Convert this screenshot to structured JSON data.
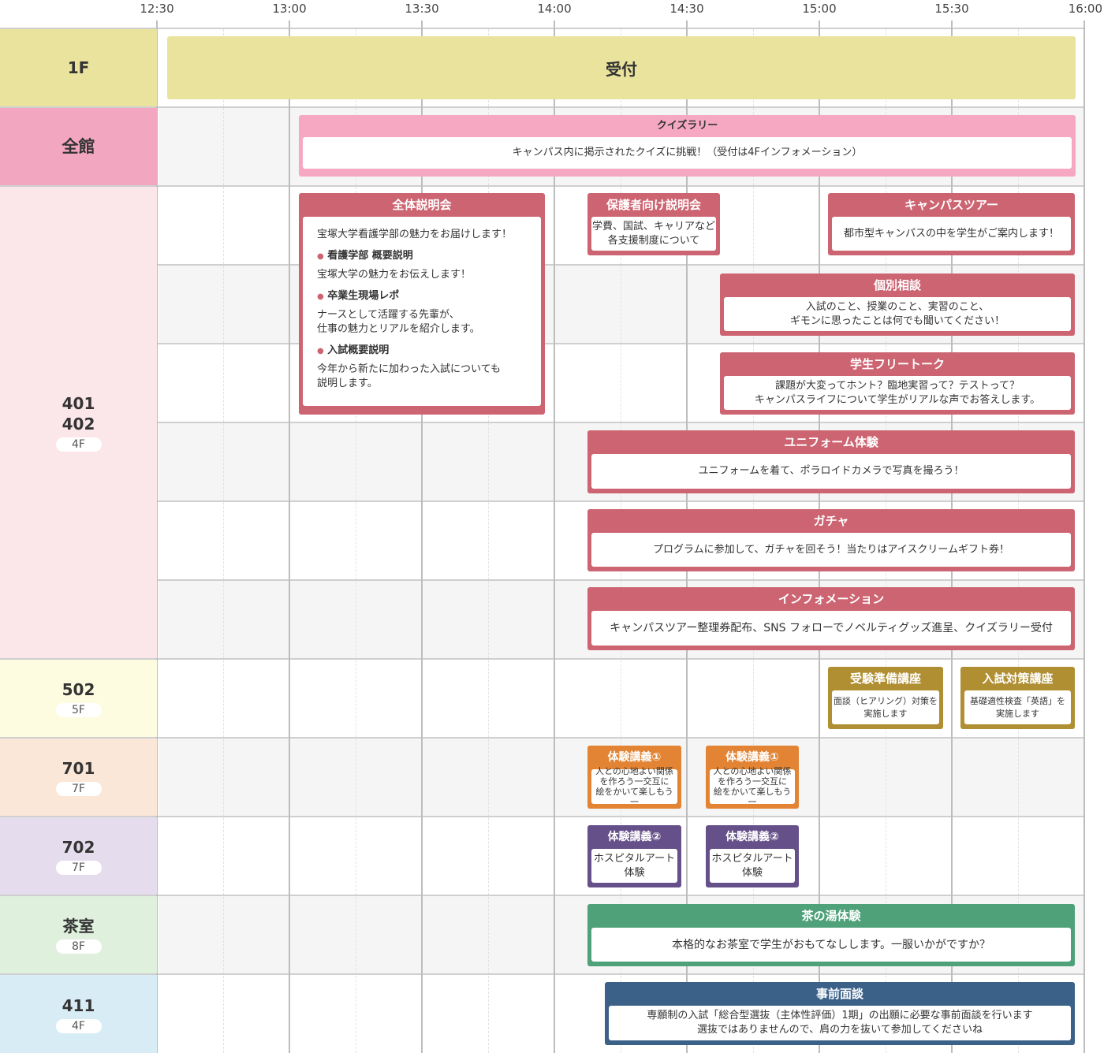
{
  "timeline": [
    "12:30",
    "13:00",
    "13:30",
    "14:00",
    "14:30",
    "15:00",
    "15:30",
    "16:00"
  ],
  "rooms": {
    "r1f": {
      "name": "1F"
    },
    "all": {
      "name": "全館"
    },
    "r401": {
      "name1": "401",
      "name2": "402",
      "floor": "4F"
    },
    "r502": {
      "name": "502",
      "floor": "5F"
    },
    "r701": {
      "name": "701",
      "floor": "7F"
    },
    "r702": {
      "name": "702",
      "floor": "7F"
    },
    "tea": {
      "name": "茶室",
      "floor": "8F"
    },
    "r411": {
      "name": "411",
      "floor": "4F"
    }
  },
  "events": {
    "reception": {
      "title": "受付"
    },
    "quiz": {
      "title": "クイズラリー",
      "body": "キャンパス内に掲示されたクイズに挑戦！（受付は4Fインフォメーション）"
    },
    "briefing": {
      "title": "全体説明会",
      "intro": "宝塚大学看護学部の魅力をお届けします！",
      "items": [
        {
          "head": "看護学部 概要説明",
          "text1": "宝塚大学の魅力をお伝えします！",
          "text2": ""
        },
        {
          "head": "卒業生現場レポ",
          "text1": "ナースとして活躍する先輩が、",
          "text2": "仕事の魅力とリアルを紹介します。"
        },
        {
          "head": "入試概要説明",
          "text1": "今年から新たに加わった入試についても",
          "text2": "説明します。"
        }
      ]
    },
    "parents": {
      "title": "保護者向け説明会",
      "line1": "学費、国試、キャリアなど",
      "line2": "各支援制度について"
    },
    "tour": {
      "title": "キャンパスツアー",
      "body": "都市型キャンパスの中を学生がご案内します！"
    },
    "consult": {
      "title": "個別相談",
      "line1": "入試のこと、授業のこと、実習のこと、",
      "line2": "ギモンに思ったことは何でも聞いてください！"
    },
    "freetalk": {
      "title": "学生フリートーク",
      "line1": "課題が大変ってホント？臨地実習って？テストって？",
      "line2": "キャンパスライフについて学生がリアルな声でお答えします。"
    },
    "uniform": {
      "title": "ユニフォーム体験",
      "body": "ユニフォームを着て、ポラロイドカメラで写真を撮ろう！"
    },
    "gacha": {
      "title": "ガチャ",
      "body": "プログラムに参加して、ガチャを回そう！当たりはアイスクリームギフト券！"
    },
    "info": {
      "title": "インフォメーション",
      "body": "キャンパスツアー整理券配布、SNS フォローでノベルティグッズ進呈、クイズラリー受付"
    },
    "prep": {
      "title": "受験準備講座",
      "line1": "面談（ヒアリング）対策を",
      "line2": "実施します"
    },
    "exam": {
      "title": "入試対策講座",
      "line1": "基礎適性検査「英語」を",
      "line2": "実施します"
    },
    "lec1a": {
      "title": "体験講義①",
      "line1": "人との心地よい関係",
      "line2": "を作ろう一交互に",
      "line3": "絵をかいて楽しもう一"
    },
    "lec1b": {
      "title": "体験講義①",
      "line1": "人との心地よい関係",
      "line2": "を作ろう一交互に",
      "line3": "絵をかいて楽しもう一"
    },
    "lec2a": {
      "title": "体験講義②",
      "line1": "ホスピタルアート",
      "line2": "体験"
    },
    "lec2b": {
      "title": "体験講義②",
      "line1": "ホスピタルアート",
      "line2": "体験"
    },
    "tea": {
      "title": "茶の湯体験",
      "body": "本格的なお茶室で学生がおもてなしします。一服いかがですか？"
    },
    "interview": {
      "title": "事前面談",
      "line1": "専願制の入試「総合型選抜（主体性評価）1期」の出願に必要な事前面談を行います",
      "line2": "選抜ではありませんので、肩の力を抜いて参加してくださいね"
    }
  },
  "colors": {
    "event_red": "#cd6471",
    "event_gold": "#b08f33",
    "event_orange": "#e28434",
    "event_purple": "#66508a",
    "event_green": "#4fa17a",
    "event_navy": "#3c6189",
    "quiz_pink": "#f6a8c3",
    "reception": "#e9e39d"
  }
}
